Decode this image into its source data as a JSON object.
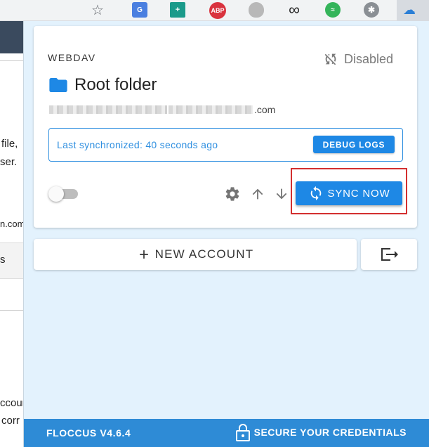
{
  "browser": {
    "extension_icons": [
      "star-add-icon",
      "google-translate-icon",
      "grid-icon",
      "adblock-plus-icon",
      "ghost-icon",
      "infinity-icon",
      "audio-wave-icon",
      "palm-tree-icon",
      "cloud-icon"
    ],
    "abp_label": "ABP",
    "translate_label": "G",
    "infinity_glyph": "∞"
  },
  "background_page": {
    "fragments": [
      "file,",
      "ser.",
      "n.com",
      "s",
      "ccour",
      "corr"
    ]
  },
  "account": {
    "type": "WEBDAV",
    "status": "Disabled",
    "folder_name": "Root folder",
    "url_suffix": ".com",
    "last_sync": "Last synchronized: 40 seconds ago",
    "debug_label": "DEBUG LOGS",
    "sync_now_label": "SYNC NOW",
    "enabled": false
  },
  "actions": {
    "new_account_label": "NEW ACCOUNT"
  },
  "footer": {
    "version": "FLOCCUS V4.6.4",
    "secure_label": "SECURE YOUR CREDENTIALS"
  },
  "colors": {
    "primary": "#1e88e5",
    "popup_bg": "#e3f2fd",
    "footer_bg": "#2e8bd6",
    "highlight": "#d32f2f"
  }
}
